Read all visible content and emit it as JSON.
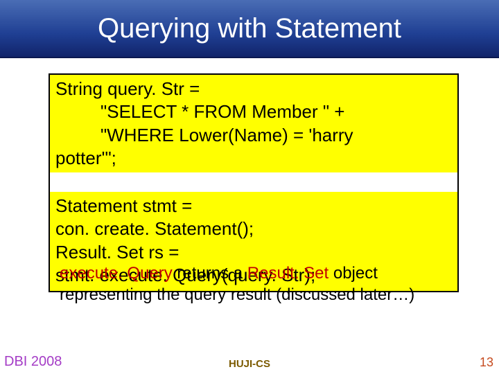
{
  "title": "Querying with Statement",
  "code": {
    "line1": "String query. Str =",
    "line2": "         \"SELECT * FROM Member \" +",
    "line3": "         \"WHERE Lower(Name) = 'harry",
    "line4": "potter'\";",
    "line5": "Statement stmt =",
    "line6": "con. create. Statement();",
    "line7": "Result. Set rs =",
    "line8": "stmt. execute. Query(query. Str);"
  },
  "note": {
    "row1_prefix": "execute. Query",
    "row1_mid": " returns a ",
    "row1_obj": "Result. Set",
    "row1_suffix": " object",
    "row2": "representing the query result (discussed later…)"
  },
  "footer": {
    "left": "DBI 2008",
    "center": "HUJI-CS",
    "right": "13"
  }
}
